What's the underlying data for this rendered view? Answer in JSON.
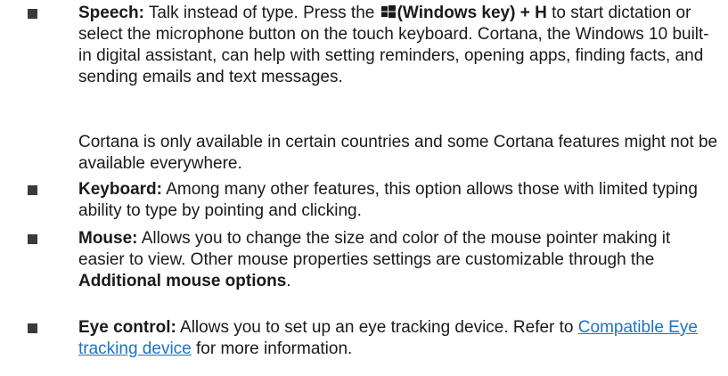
{
  "items": [
    {
      "term": "Speech:",
      "parts": {
        "a": " Talk instead of type. Press the ",
        "key": "(Windows key) + H",
        "b": " to start dictation or select the microphone button on the touch keyboard. Cortana, the Windows 10 built-in digital assistant, can help with setting reminders, opening apps, finding facts, and sending emails and text messages."
      },
      "icon": "windows-logo-icon",
      "note": "Cortana is only available in certain countries and some Cortana features might not be available everywhere."
    },
    {
      "term": "Keyboard:",
      "text": " Among many other features, this option allows those with limited typing ability to type by pointing and clicking."
    },
    {
      "term": "Mouse:",
      "text": " Allows you to change the size and color of the mouse pointer making it easier to view. Other mouse properties settings are customizable through the ",
      "bold_tail": "Additional mouse options",
      "tail_end": "."
    },
    {
      "term": "Eye control:",
      "text": " Allows you to set up an eye tracking device. Refer to ",
      "link": "Compatible Eye tracking device",
      "tail": " for more information."
    }
  ],
  "colors": {
    "text": "#1a1a1a",
    "link": "#1a73c9",
    "bullet": "#3a3a3a"
  }
}
